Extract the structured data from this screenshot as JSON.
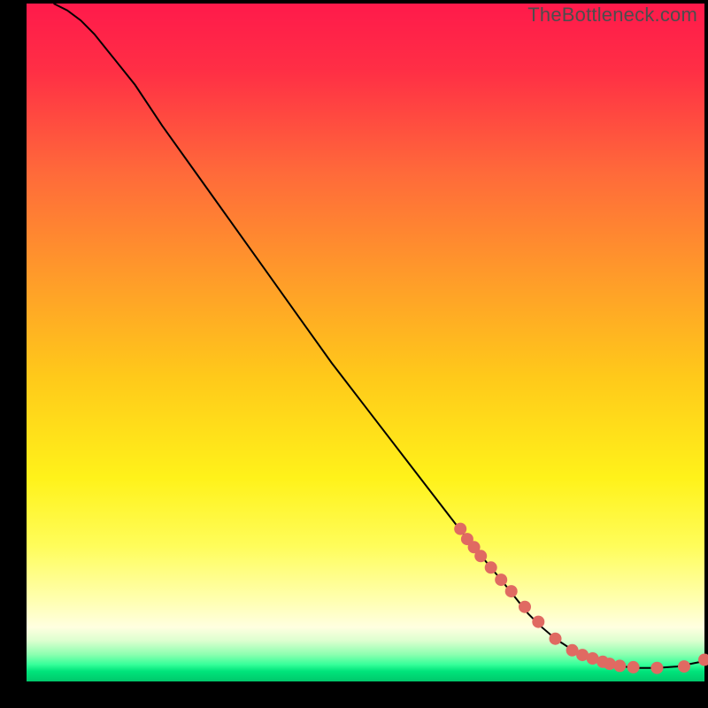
{
  "watermark": "TheBottleneck.com",
  "chart_data": {
    "type": "line",
    "title": "",
    "xlabel": "",
    "ylabel": "",
    "xlim": [
      0,
      100
    ],
    "ylim": [
      0,
      100
    ],
    "grid": false,
    "background": {
      "stops": [
        {
          "offset": 0.0,
          "color": "#ff1a4b"
        },
        {
          "offset": 0.1,
          "color": "#ff2f45"
        },
        {
          "offset": 0.25,
          "color": "#ff6a3a"
        },
        {
          "offset": 0.4,
          "color": "#ff9a2a"
        },
        {
          "offset": 0.55,
          "color": "#ffc91a"
        },
        {
          "offset": 0.7,
          "color": "#fff21a"
        },
        {
          "offset": 0.8,
          "color": "#fffd5a"
        },
        {
          "offset": 0.88,
          "color": "#ffffb0"
        },
        {
          "offset": 0.92,
          "color": "#ffffe0"
        },
        {
          "offset": 0.94,
          "color": "#dcffcf"
        },
        {
          "offset": 0.96,
          "color": "#8dffb0"
        },
        {
          "offset": 0.975,
          "color": "#36ff9a"
        },
        {
          "offset": 0.985,
          "color": "#00e47b"
        },
        {
          "offset": 1.0,
          "color": "#00c86b"
        }
      ]
    },
    "series": [
      {
        "name": "bottleneck-curve",
        "stroke": "#000000",
        "x": [
          4,
          6,
          8,
          10,
          12,
          16,
          20,
          25,
          30,
          35,
          40,
          45,
          50,
          55,
          60,
          65,
          70,
          74,
          76,
          78,
          80,
          83,
          86,
          88,
          90,
          93,
          96,
          100
        ],
        "y": [
          100,
          99,
          97.5,
          95.5,
          93,
          88,
          82,
          75,
          68,
          61,
          54,
          47,
          40.5,
          34,
          27.5,
          21,
          15,
          10,
          8,
          6.3,
          5,
          3.7,
          2.7,
          2.2,
          2,
          2,
          2.2,
          3
        ],
        "marker_mask": [
          0,
          0,
          0,
          0,
          0,
          0,
          0,
          0,
          0,
          0,
          0,
          0,
          0,
          0,
          0,
          0,
          0,
          0,
          0,
          0,
          0,
          0,
          0,
          0,
          0,
          0,
          0,
          0
        ]
      },
      {
        "name": "highlighted-points",
        "stroke": "none",
        "marker_fill": "#e06a62",
        "marker_r": 7,
        "x": [
          64,
          65,
          66,
          67,
          68.5,
          70,
          71.5,
          73.5,
          75.5,
          78,
          80.5,
          82,
          83.5,
          85,
          86,
          87.5,
          89.5,
          93,
          97,
          100
        ],
        "y": [
          22.5,
          21,
          19.8,
          18.5,
          16.8,
          15,
          13.3,
          11.0,
          8.8,
          6.3,
          4.6,
          3.9,
          3.4,
          2.9,
          2.6,
          2.3,
          2.1,
          2.0,
          2.2,
          3.2
        ]
      }
    ]
  }
}
